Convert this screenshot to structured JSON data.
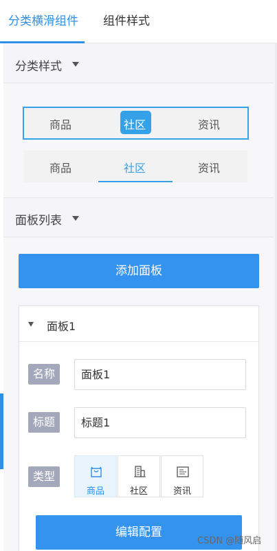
{
  "tabs": [
    {
      "label": "分类横滑组件",
      "active": true
    },
    {
      "label": "组件样式",
      "active": false
    }
  ],
  "category_section": {
    "title": "分类样式",
    "style_outline": {
      "items": [
        "商品",
        "社区",
        "资讯"
      ],
      "selected": "社区"
    },
    "style_underline": {
      "items": [
        "商品",
        "社区",
        "资讯"
      ],
      "selected": "社区"
    }
  },
  "panel_section": {
    "title": "面板列表",
    "add_button": "添加面板",
    "panel": {
      "title": "面板1",
      "name_label": "名称",
      "name_value": "面板1",
      "heading_label": "标题",
      "heading_value": "标题1",
      "type_label": "类型",
      "type_options": [
        {
          "label": "商品",
          "icon": "bag-icon",
          "selected": true
        },
        {
          "label": "社区",
          "icon": "building-icon",
          "selected": false
        },
        {
          "label": "资讯",
          "icon": "news-icon",
          "selected": false
        }
      ],
      "edit_button": "编辑配置"
    }
  },
  "watermark": "CSDN @随风启",
  "colors": {
    "accent": "#2f8fe8",
    "button": "#3593f0",
    "label_bg": "#a3a8bb"
  }
}
